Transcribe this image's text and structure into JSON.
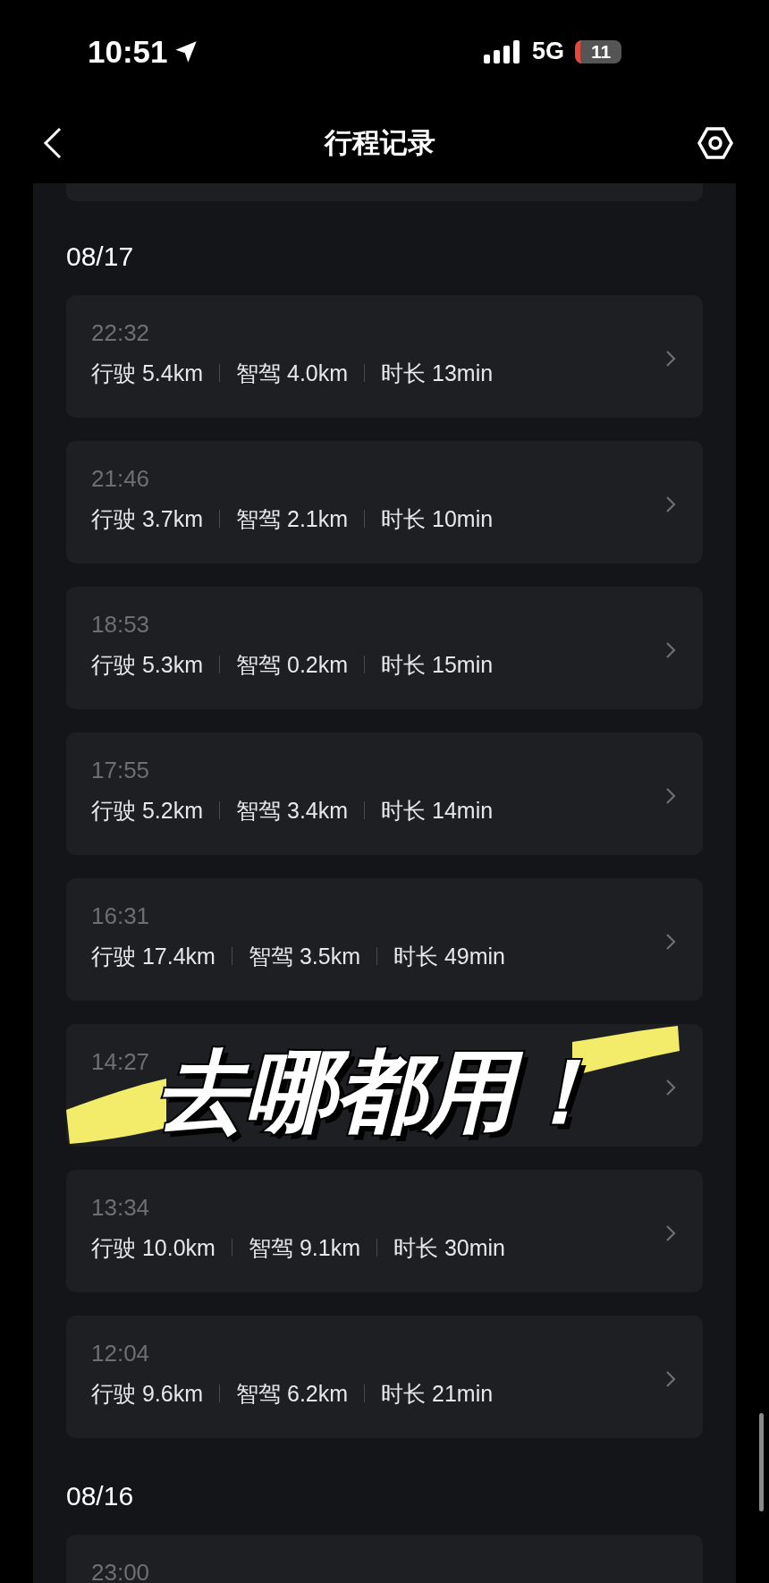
{
  "status_bar": {
    "time": "10:51",
    "network": "5G",
    "battery": "11",
    "battery_low": true
  },
  "nav": {
    "title": "行程记录"
  },
  "sections": [
    {
      "date": "08/17",
      "trips": [
        {
          "time": "22:32",
          "stats": [
            {
              "label": "行驶",
              "value": "5.4km"
            },
            {
              "label": "智驾",
              "value": "4.0km"
            },
            {
              "label": "时长",
              "value": "13min"
            }
          ]
        },
        {
          "time": "21:46",
          "stats": [
            {
              "label": "行驶",
              "value": "3.7km"
            },
            {
              "label": "智驾",
              "value": "2.1km"
            },
            {
              "label": "时长",
              "value": "10min"
            }
          ]
        },
        {
          "time": "18:53",
          "stats": [
            {
              "label": "行驶",
              "value": "5.3km"
            },
            {
              "label": "智驾",
              "value": "0.2km"
            },
            {
              "label": "时长",
              "value": "15min"
            }
          ]
        },
        {
          "time": "17:55",
          "stats": [
            {
              "label": "行驶",
              "value": "5.2km"
            },
            {
              "label": "智驾",
              "value": "3.4km"
            },
            {
              "label": "时长",
              "value": "14min"
            }
          ]
        },
        {
          "time": "16:31",
          "stats": [
            {
              "label": "行驶",
              "value": "17.4km"
            },
            {
              "label": "智驾",
              "value": "3.5km"
            },
            {
              "label": "时长",
              "value": "49min"
            }
          ]
        },
        {
          "time": "14:27",
          "caption": {
            "text": "去哪都用！"
          }
        },
        {
          "time": "13:34",
          "stats": [
            {
              "label": "行驶",
              "value": "10.0km"
            },
            {
              "label": "智驾",
              "value": "9.1km"
            },
            {
              "label": "时长",
              "value": "30min"
            }
          ]
        },
        {
          "time": "12:04",
          "stats": [
            {
              "label": "行驶",
              "value": "9.6km"
            },
            {
              "label": "智驾",
              "value": "6.2km"
            },
            {
              "label": "时长",
              "value": "21min"
            }
          ]
        }
      ]
    },
    {
      "date": "08/16",
      "trips": [
        {
          "time": "23:00"
        }
      ]
    }
  ]
}
